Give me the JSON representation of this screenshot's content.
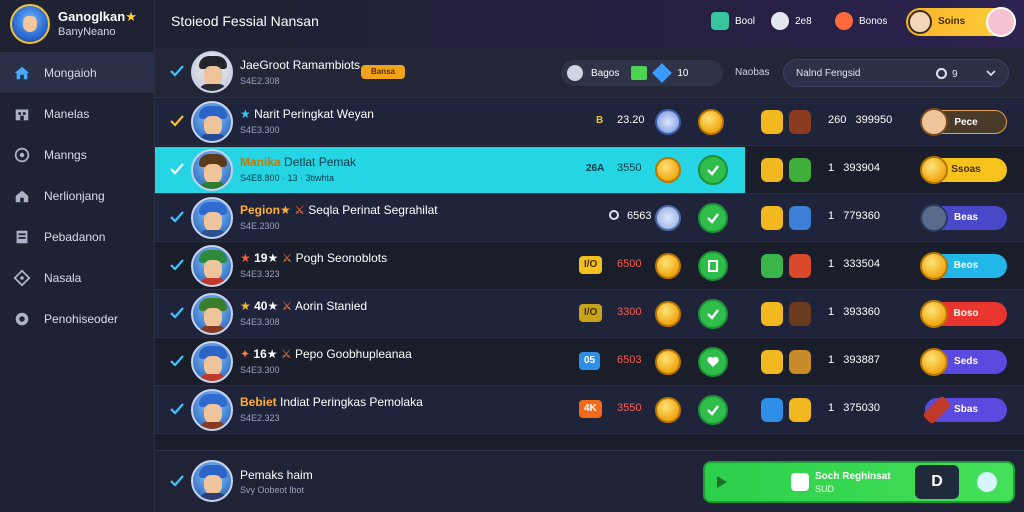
{
  "brand": {
    "title": "Ganoglkan",
    "star": "★",
    "subtitle": "BanyNeano"
  },
  "sidebar": {
    "items": [
      {
        "label": "Mongaioh",
        "icon": "home-icon"
      },
      {
        "label": "Manelas",
        "icon": "building-icon"
      },
      {
        "label": "Manngs",
        "icon": "target-icon"
      },
      {
        "label": "Nerlionjang",
        "icon": "house-icon"
      },
      {
        "label": "Pebadanon",
        "icon": "document-icon"
      },
      {
        "label": "Nasala",
        "icon": "diamond-icon"
      },
      {
        "label": "Penohiseoder",
        "icon": "gear-icon"
      }
    ]
  },
  "header": {
    "title": "Stoieod Fessial Nansan",
    "stat1": "Bool",
    "stat2": "2e8",
    "stat3": "Bonos",
    "coin_label": "Soins"
  },
  "top": {
    "player_name": "JaeGroot Ramambiots",
    "player_sub": "S4E2.308",
    "badge": "Bansa",
    "search_label": "Bagos",
    "search_count": "10",
    "filter_label": "Naobas",
    "dropdown_value": "Nalnd Fengsid",
    "dropdown_count": "9"
  },
  "rows": [
    {
      "tag": "",
      "name": "Narit Peringkat Weyan",
      "sub": "S4E3.300",
      "badge": "B",
      "badge_color": "#f2c11f",
      "score": "23.20",
      "pts": "260",
      "pts2": "399950",
      "pill": "Pece",
      "pill_color": "#4a3a2a"
    },
    {
      "tag": "Manika",
      "name": "Detlat Pemak",
      "sub": "S4E8.800 · 13 · 3tiwhta",
      "badge": "26A",
      "badge_color": "",
      "score": "3550",
      "pts": "1",
      "pts2": "393904",
      "pill": "Ssoas",
      "pill_color": "#f6c21c"
    },
    {
      "tag": "Pegion★",
      "name": "Seqla Perinat Segrahilat",
      "sub": "S4E.2300",
      "badge": "",
      "badge_color": "",
      "score": "6563",
      "pts": "1",
      "pts2": "779360",
      "pill": "Beas",
      "pill_color": "#4b47c9"
    },
    {
      "tag": "19★",
      "name": "Pogh Seonoblots",
      "sub": "S4E3.323",
      "badge": "I/O",
      "badge_color": "#f2c11f",
      "score": "6500",
      "pts": "1",
      "pts2": "333504",
      "pill": "Beos",
      "pill_color": "#22b7e8"
    },
    {
      "tag": "40★",
      "name": "Aorin Stanied",
      "sub": "S4E3.308",
      "badge": "I/O",
      "badge_color": "#f2c11f",
      "score": "3300",
      "pts": "1",
      "pts2": "393360",
      "pill": "Boso",
      "pill_color": "#e8352d"
    },
    {
      "tag": "16★",
      "name": "Pepo Goobhupleanaa",
      "sub": "S4E3.300",
      "badge": "05",
      "badge_color": "#2f8fe6",
      "score": "6503",
      "pts": "1",
      "pts2": "393887",
      "pill": "Seds",
      "pill_color": "#5a4ae0"
    },
    {
      "tag": "Bebiet",
      "name": "Indiat Peringkas Pemolaka",
      "sub": "S4E2.323",
      "badge": "4K",
      "badge_color": "#f26a1b",
      "score": "3550",
      "pts": "1",
      "pts2": "375030",
      "pill": "Sbas",
      "pill_color": "#5a4ae0"
    }
  ],
  "bottom": {
    "name": "Pemaks haim",
    "sub": "Svy Oobeot lbot",
    "cta_title": "Soch Reghinsat",
    "cta_sub": "SUD",
    "cta_btn": "D"
  },
  "colors": {
    "accent": "#25d5e4",
    "green": "#2fbd4c",
    "gold": "#f7b52a"
  }
}
